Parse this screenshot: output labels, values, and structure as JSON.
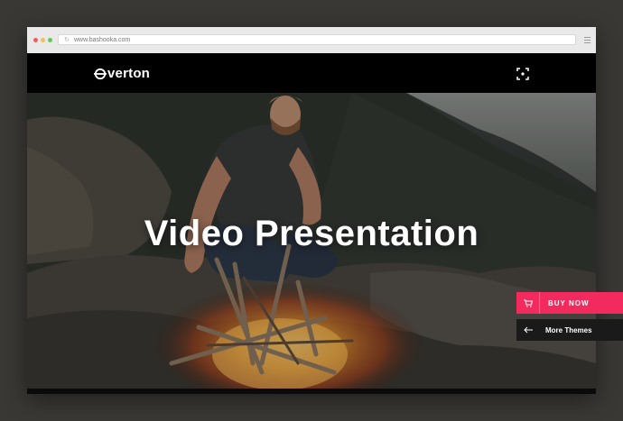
{
  "browser": {
    "url": "www.bashooka.com",
    "dot_colors": [
      "#f25e57",
      "#f6be4f",
      "#5fca5d"
    ]
  },
  "site": {
    "logo_text": "verton",
    "logo_icon": "overton-logo-icon",
    "fullscreen_icon": "expand-icon"
  },
  "hero": {
    "title": "Video Presentation",
    "image": "man-building-campfire-photo"
  },
  "buy_button": {
    "label": "BUY NOW",
    "icon": "cart-icon",
    "color": "#f32a5e"
  },
  "more_themes": {
    "label": "More Themes",
    "icon": "arrow-left-icon"
  }
}
